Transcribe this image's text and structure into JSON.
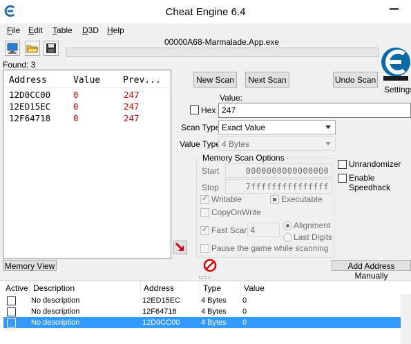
{
  "window": {
    "title": "Cheat Engine 6.4"
  },
  "menu": [
    "File",
    "Edit",
    "Table",
    "D3D",
    "Help"
  ],
  "toolbar": {
    "process_name": "00000A68-Marmalade.App.exe"
  },
  "found": "Found: 3",
  "results": {
    "headers": {
      "address": "Address",
      "value": "Value",
      "previous": "Prev..."
    },
    "rows": [
      {
        "address": "12D0CC00",
        "value": "0",
        "previous": "247"
      },
      {
        "address": "12ED15EC",
        "value": "0",
        "previous": "247"
      },
      {
        "address": "12F64718",
        "value": "0",
        "previous": "247"
      }
    ]
  },
  "buttons": {
    "new_scan": "New Scan",
    "next_scan": "Next Scan",
    "undo_scan": "Undo Scan",
    "memory_view": "Memory View",
    "add_address": "Add Address Manually"
  },
  "logo": {
    "settings_label": "Settings"
  },
  "scan": {
    "value_label": "Value:",
    "hex_label": "Hex",
    "value": "247",
    "scan_type_label": "Scan Type",
    "scan_type": "Exact Value",
    "value_type_label": "Value Type",
    "value_type": "4 Bytes"
  },
  "memory_options": {
    "title": "Memory Scan Options",
    "start_label": "Start",
    "start_value": "0000000000000000",
    "stop_label": "Stop",
    "stop_value": "7fffffffffffffff",
    "writable_label": "Writable",
    "executable_label": "Executable",
    "copyonwrite_label": "CopyOnWrite",
    "fastscan_label": "Fast Scan",
    "fastscan_value": "4",
    "alignment_label": "Alignment",
    "lastdigits_label": "Last Digits",
    "pause_label": "Pause the game while scanning"
  },
  "side_options": {
    "unrandomizer": "Unrandomizer",
    "speedhack": "Enable Speedhack"
  },
  "table": {
    "headers": {
      "active": "Active",
      "description": "Description",
      "address": "Address",
      "type": "Type",
      "value": "Value"
    },
    "rows": [
      {
        "description": "No description",
        "address": "12ED15EC",
        "type": "4 Bytes",
        "value": "0"
      },
      {
        "description": "No description",
        "address": "12F64718",
        "type": "4 Bytes",
        "value": "0"
      },
      {
        "description": "No description",
        "address": "12D0CC00",
        "type": "4 Bytes",
        "value": "0"
      }
    ]
  },
  "colors": {
    "accent_selection": "#3399ff",
    "changed_value": "#e00000",
    "logo_blue": "#0b6aa8"
  }
}
